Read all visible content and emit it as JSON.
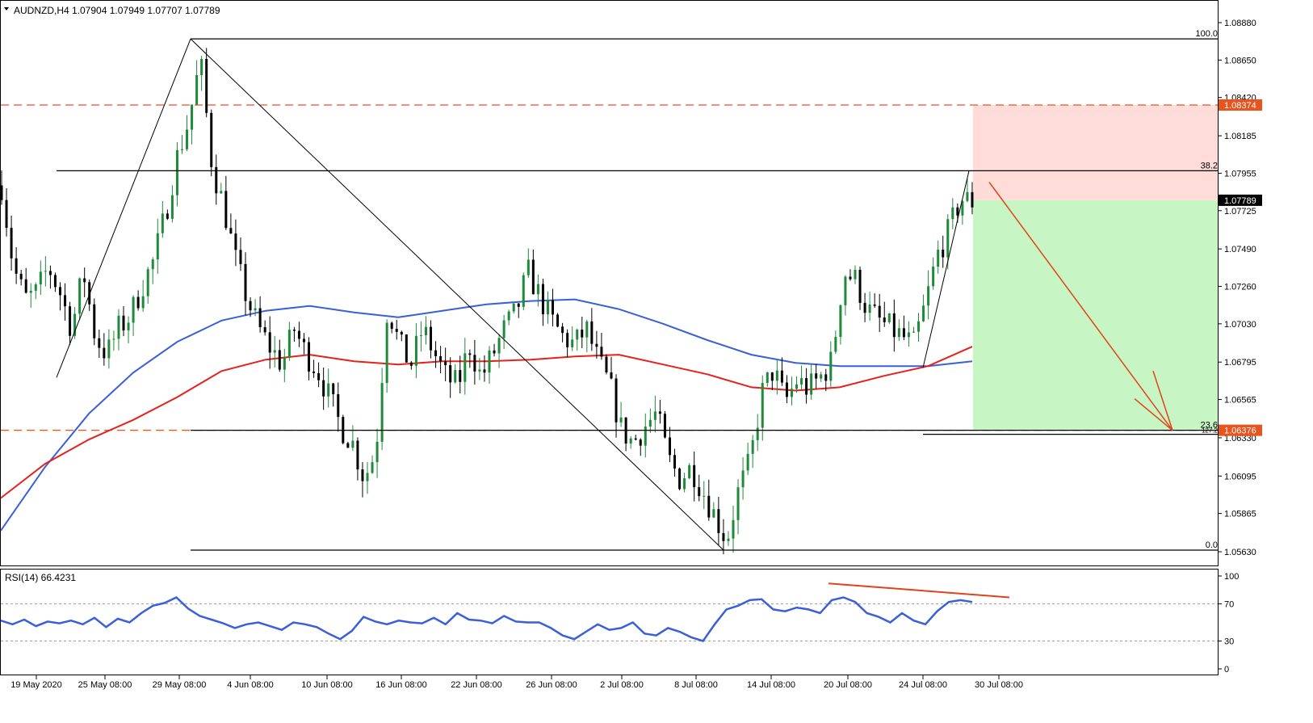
{
  "header": {
    "symbol": "AUDNZD,H4",
    "ohlc": "1.07904 1.07949 1.07707 1.07789"
  },
  "rsi": {
    "label": "RSI(14) 66.4231",
    "ticks": [
      "100",
      "70",
      "30",
      "0"
    ],
    "levels": [
      70,
      30
    ],
    "color": "#3a5fd9"
  },
  "price_axis": {
    "ticks": [
      "1.08880",
      "1.08650",
      "1.08420",
      "1.08185",
      "1.07955",
      "1.07725",
      "1.07490",
      "1.07260",
      "1.07030",
      "1.06795",
      "1.06565",
      "1.06330",
      "1.06095",
      "1.05865",
      "1.05630"
    ],
    "current_price": "1.07789",
    "stop_label": "1.08374",
    "target_label": "1.06376"
  },
  "time_axis": {
    "labels": [
      "19 May 2020",
      "25 May 08:00",
      "29 May 08:00",
      "4 Jun 08:00",
      "10 Jun 08:00",
      "16 Jun 08:00",
      "22 Jun 08:00",
      "26 Jun 08:00",
      "2 Jul 08:00",
      "8 Jul 08:00",
      "14 Jul 08:00",
      "20 Jul 08:00",
      "24 Jul 08:00",
      "30 Jul 08:00"
    ]
  },
  "fibonacci": {
    "levels": [
      {
        "label": "100.0",
        "price": 1.0878
      },
      {
        "label": "38.2",
        "price": 1.0797
      },
      {
        "label": "23.6",
        "price": 1.06376
      },
      {
        "label": "127.2",
        "price": 1.06376
      },
      {
        "label": "0.0",
        "price": 1.0564
      }
    ]
  },
  "colors": {
    "bull_candle": "#1e8a3a",
    "bear_candle": "#000000",
    "ma_fast": "#3a5fd9",
    "ma_slow": "#e8201c",
    "arrow": "#e0431a",
    "stop_zone": "#ffdcd8",
    "target_zone": "#c8f5c4",
    "dashed": "#e8541e",
    "price_tag": "#000000"
  },
  "chart_data": {
    "type": "candlestick",
    "symbol": "AUDNZD",
    "timeframe": "H4",
    "ylim": [
      1.0553,
      1.09
    ],
    "x_labels": [
      "19 May 2020",
      "25 May 08:00",
      "29 May 08:00",
      "4 Jun 08:00",
      "10 Jun 08:00",
      "16 Jun 08:00",
      "22 Jun 08:00",
      "26 Jun 08:00",
      "2 Jul 08:00",
      "8 Jul 08:00",
      "14 Jul 08:00",
      "20 Jul 08:00",
      "24 Jul 08:00",
      "30 Jul 08:00"
    ],
    "close_path": [
      1.0788,
      1.0738,
      1.0718,
      1.0722,
      1.0738,
      1.0722,
      1.07,
      1.0735,
      1.0695,
      1.0684,
      1.07,
      1.0708,
      1.0726,
      1.0742,
      1.077,
      1.0805,
      1.0828,
      1.0865,
      1.08,
      1.0775,
      1.0742,
      1.0718,
      1.07,
      1.0688,
      1.0678,
      1.07,
      1.0685,
      1.0675,
      1.0658,
      1.064,
      1.063,
      1.0608,
      1.0625,
      1.0715,
      1.069,
      1.0678,
      1.07,
      1.0685,
      1.067,
      1.0665,
      1.069,
      1.067,
      1.0684,
      1.07,
      1.071,
      1.0735,
      1.072,
      1.0705,
      1.0695,
      1.069,
      1.07,
      1.068,
      1.0665,
      1.0638,
      1.063,
      1.064,
      1.0648,
      1.062,
      1.0608,
      1.0615,
      1.06,
      1.0585,
      1.057,
      1.06,
      1.0618,
      1.066,
      1.0675,
      1.0655,
      1.0668,
      1.0663,
      1.067,
      1.068,
      1.0735,
      1.073,
      1.0712,
      1.0705,
      1.07,
      1.0695,
      1.069,
      1.0715,
      1.0745,
      1.076,
      1.078,
      1.0778
    ],
    "moving_averages": [
      {
        "color": "#3a5fd9",
        "values": [
          1.0576,
          1.0615,
          1.0648,
          1.0673,
          1.0692,
          1.0705,
          1.0711,
          1.0714,
          1.071,
          1.0707,
          1.0711,
          1.0715,
          1.0717,
          1.0718,
          1.0712,
          1.0703,
          1.0693,
          1.0684,
          1.0679,
          1.0677,
          1.0677,
          1.0677,
          1.068
        ]
      },
      {
        "color": "#e8201c",
        "values": [
          1.0596,
          1.0617,
          1.0632,
          1.0644,
          1.0658,
          1.0674,
          1.0681,
          1.0684,
          1.068,
          1.0678,
          1.068,
          1.068,
          1.0681,
          1.0683,
          1.0684,
          1.0678,
          1.0672,
          1.0664,
          1.0662,
          1.0664,
          1.0671,
          1.0677,
          1.0689
        ]
      }
    ],
    "trade_setup": {
      "entry": 1.07789,
      "stop": 1.08374,
      "target": 1.06376
    },
    "rsi": {
      "period": 14,
      "last": 66.4231,
      "ylim": [
        0,
        100
      ],
      "values": [
        52,
        48,
        53,
        46,
        51,
        49,
        52,
        48,
        55,
        45,
        54,
        50,
        60,
        68,
        71,
        77,
        65,
        57,
        53,
        49,
        44,
        48,
        50,
        46,
        42,
        50,
        48,
        45,
        38,
        32,
        41,
        56,
        51,
        48,
        52,
        50,
        49,
        55,
        48,
        60,
        53,
        52,
        49,
        57,
        51,
        50,
        50,
        44,
        36,
        32,
        40,
        48,
        42,
        44,
        50,
        38,
        36,
        44,
        40,
        34,
        30,
        48,
        64,
        68,
        74,
        75,
        64,
        62,
        66,
        64,
        60,
        74,
        77,
        72,
        60,
        56,
        50,
        60,
        52,
        48,
        62,
        72,
        74,
        72
      ]
    }
  }
}
